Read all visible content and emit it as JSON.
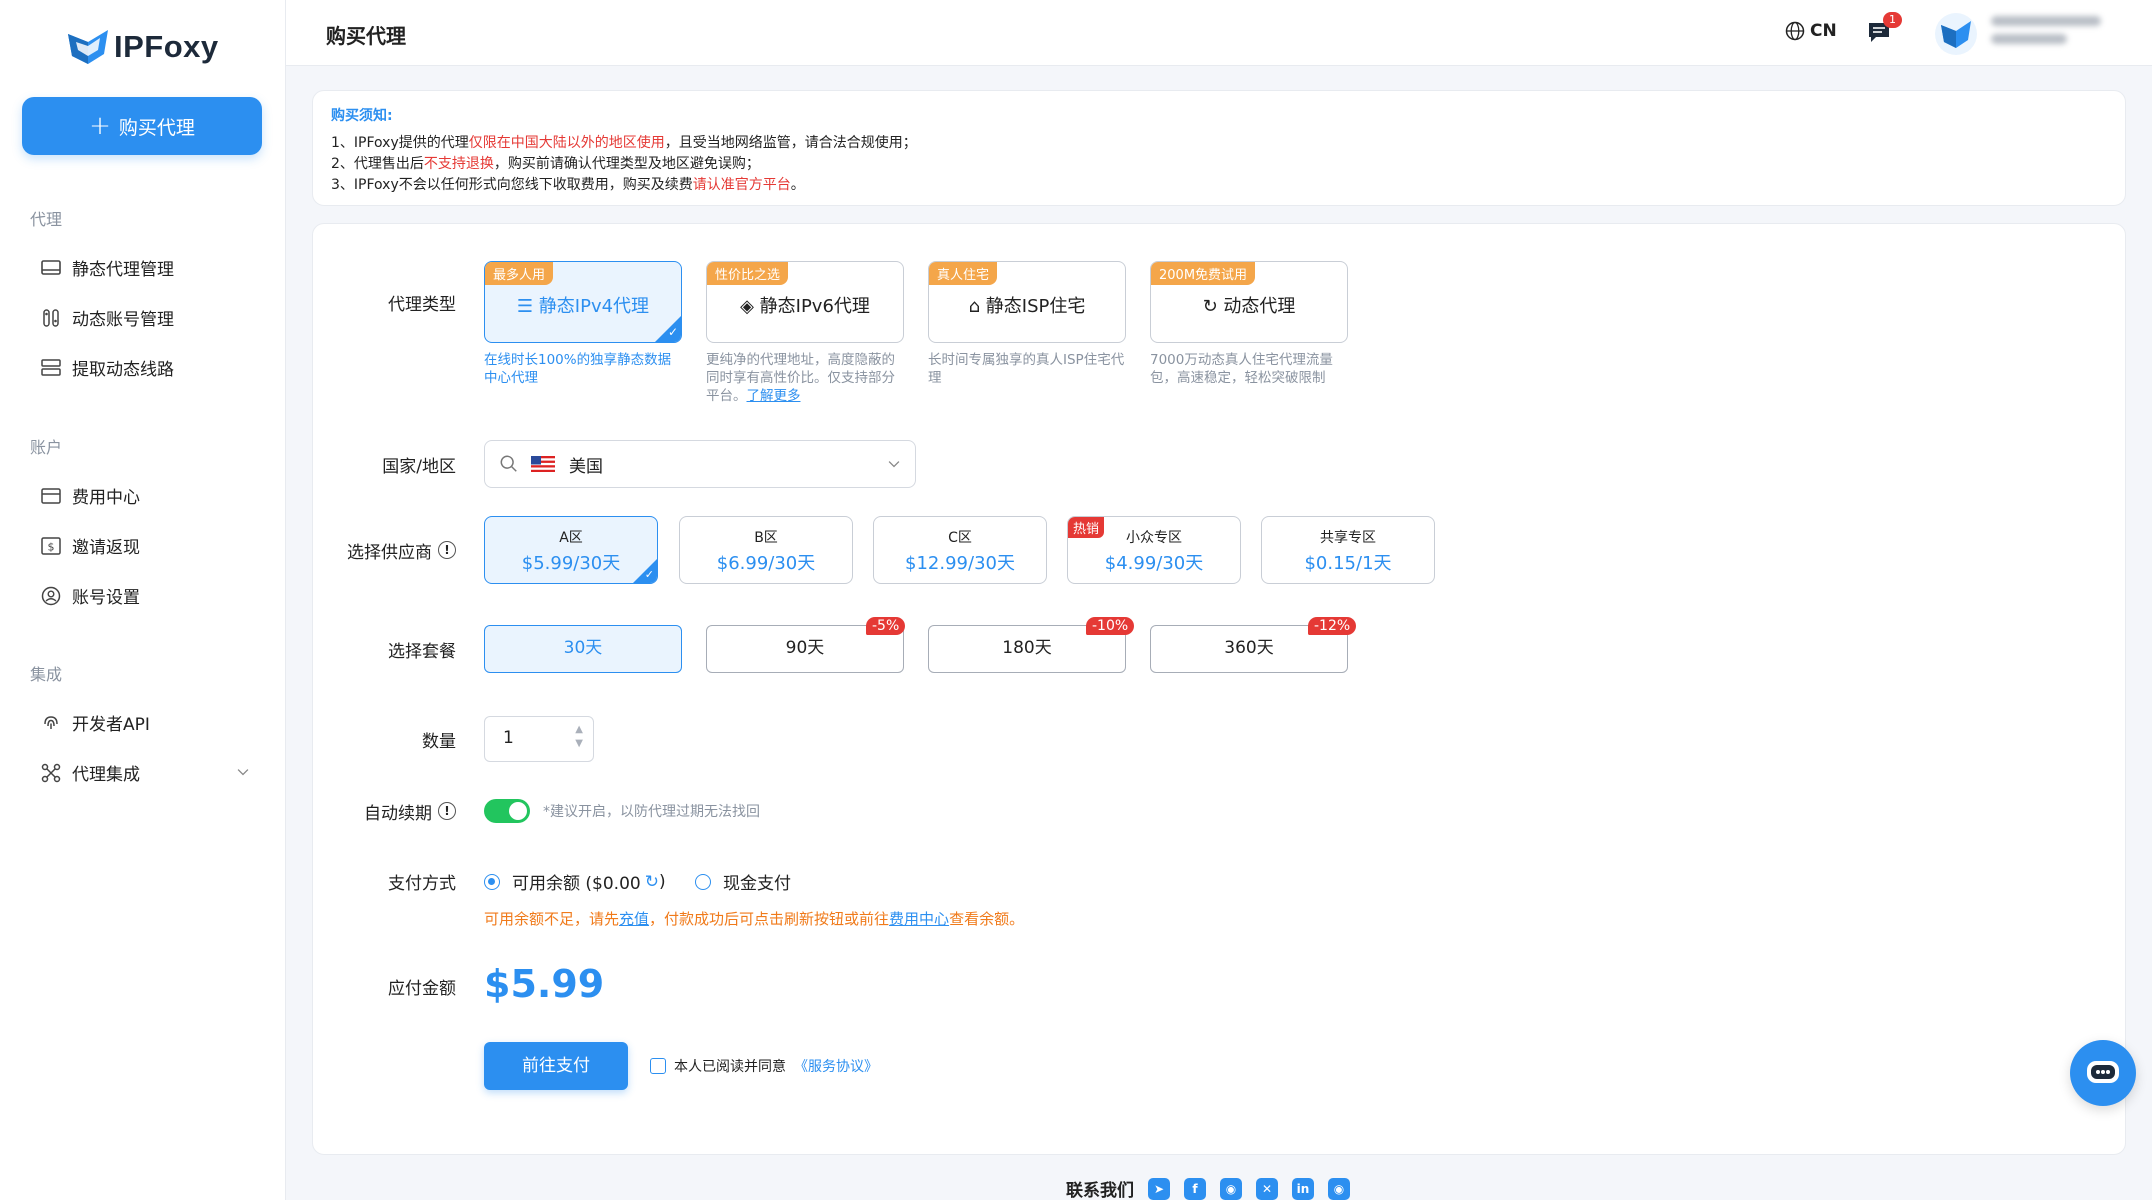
{
  "brand": {
    "name": "IPFoxy"
  },
  "sidebar": {
    "buy_label": "购买代理",
    "sections": [
      {
        "title": "代理",
        "items": [
          {
            "label": "静态代理管理"
          },
          {
            "label": "动态账号管理"
          },
          {
            "label": "提取动态线路"
          }
        ]
      },
      {
        "title": "账户",
        "items": [
          {
            "label": "费用中心"
          },
          {
            "label": "邀请返现"
          },
          {
            "label": "账号设置"
          }
        ]
      },
      {
        "title": "集成",
        "items": [
          {
            "label": "开发者API"
          },
          {
            "label": "代理集成"
          }
        ]
      }
    ]
  },
  "header": {
    "title": "购买代理",
    "lang": "CN",
    "msg_count": "1"
  },
  "notice": {
    "title": "购买须知:",
    "line1_a": "1、IPFoxy提供的代理",
    "line1_red": "仅限在中国大陆以外的地区使用",
    "line1_b": "，且受当地网络监管，请合法合规使用；",
    "line2_a": "2、代理售出后",
    "line2_red": "不支持退换",
    "line2_b": "，购买前请确认代理类型及地区避免误购；",
    "line3_a": "3、IPFoxy不会以任何形式向您线下收取费用，购买及续费",
    "line3_red": "请认准官方平台",
    "line3_b": "。"
  },
  "form": {
    "proxy_type_label": "代理类型",
    "proxy_types": [
      {
        "tag": "最多人用",
        "name": "静态IPv4代理",
        "desc": "在线时长100%的独享静态数据中心代理"
      },
      {
        "tag": "性价比之选",
        "name": "静态IPv6代理",
        "desc": "更纯净的代理地址，高度隐蔽的同时享有高性价比。仅支持部分平台。",
        "link": "了解更多"
      },
      {
        "tag": "真人住宅",
        "name": "静态ISP住宅",
        "desc": "长时间专属独享的真人ISP住宅代理"
      },
      {
        "tag": "200M免费试用",
        "name": "动态代理",
        "desc": "7000万动态真人住宅代理流量包，高速稳定，轻松突破限制"
      }
    ],
    "country_label": "国家/地区",
    "country_value": "美国",
    "provider_label": "选择供应商",
    "providers": [
      {
        "name": "A区",
        "price": "$5.99/30天"
      },
      {
        "name": "B区",
        "price": "$6.99/30天"
      },
      {
        "name": "C区",
        "price": "$12.99/30天"
      },
      {
        "name": "小众专区",
        "price": "$4.99/30天",
        "hot": "热销"
      },
      {
        "name": "共享专区",
        "price": "$0.15/1天"
      }
    ],
    "plan_label": "选择套餐",
    "plans": [
      {
        "label": "30天"
      },
      {
        "label": "90天",
        "discount": "-5%"
      },
      {
        "label": "180天",
        "discount": "-10%"
      },
      {
        "label": "360天",
        "discount": "-12%"
      }
    ],
    "qty_label": "数量",
    "qty_value": "1",
    "renew_label": "自动续期",
    "renew_hint": "*建议开启，以防代理过期无法找回",
    "pay_method_label": "支付方式",
    "balance_label": "可用余额 ($0.00",
    "balance_close": ")",
    "cash_label": "现金支付",
    "warn_a": "可用余额不足，请先",
    "warn_link1": "充值",
    "warn_b": "，付款成功后可点击刷新按钮或前往",
    "warn_link2": "费用中心",
    "warn_c": "查看余额。",
    "amount_label": "应付金额",
    "amount_value": "$5.99",
    "pay_button": "前往支付",
    "agree_text": "本人已阅读并同意",
    "agree_link": "《服务协议》"
  },
  "footer": {
    "contact": "联系我们"
  },
  "colors": {
    "accent": "#2c8ff0",
    "tag_orange": "#f4a64a",
    "danger": "#e53935",
    "success": "#22c55e",
    "warn": "#f07a1a"
  }
}
